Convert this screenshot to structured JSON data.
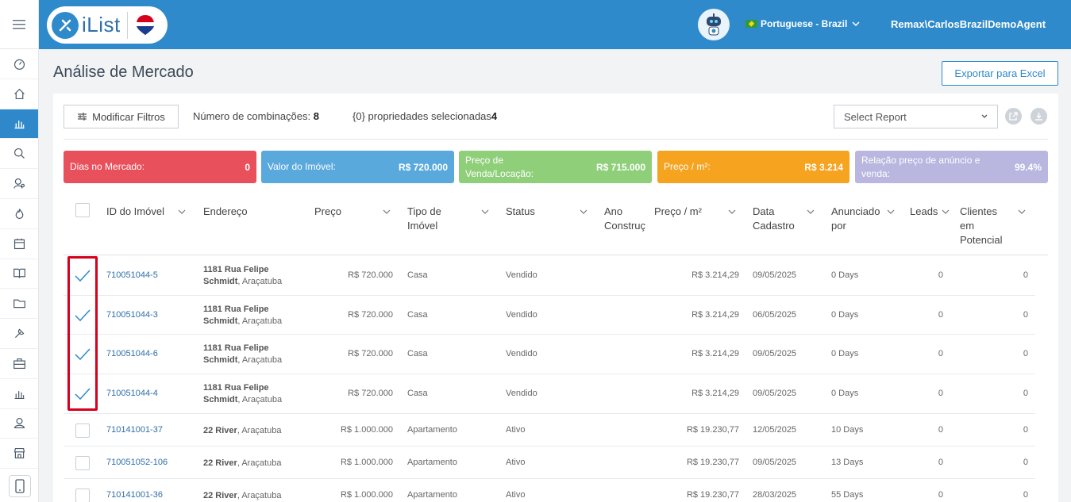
{
  "app": {
    "logo_text": "iList",
    "language": "Portuguese - Brazil",
    "user": "Remax\\CarlosBrazilDemoAgent"
  },
  "page": {
    "title": "Análise de Mercado",
    "export_label": "Exportar para Excel"
  },
  "toolbar": {
    "modify_filters": "Modificar Filtros",
    "combinations_label": "Número de combinações:",
    "combinations_value": "8",
    "selected_label": "{0} propriedades selecionadas",
    "selected_value": "4",
    "select_report_placeholder": "Select Report"
  },
  "kpis": [
    {
      "label": "Dias no Mercado:",
      "value": "0",
      "color": "#e8505b"
    },
    {
      "label": "Valor do Imóvel:",
      "value": "R$ 720.000",
      "color": "#5aa9dd"
    },
    {
      "label": "Preço de Venda/Locação:",
      "value": "R$ 715.000",
      "color": "#8fcf7a"
    },
    {
      "label": "Preço / m²:",
      "value": "R$ 3.214",
      "color": "#f6a320"
    },
    {
      "label": "Relação preço de anúncio e venda:",
      "value": "99.4%",
      "color": "#b9b6e0"
    }
  ],
  "columns": {
    "id": "ID do Imóvel",
    "address": "Endereço",
    "price": "Preço",
    "type_1": "Tipo de",
    "type_2": "Imóvel",
    "status": "Status",
    "year_1": "Ano",
    "year_2": "Construç",
    "ppm": "Preço / m²",
    "date_1": "Data",
    "date_2": "Cadastro",
    "listed_1": "Anunciado",
    "listed_2": "por",
    "leads": "Leads",
    "clients_1": "Clientes",
    "clients_2": "em",
    "clients_3": "Potencial"
  },
  "rows": [
    {
      "checked": true,
      "id": "710051044-5",
      "street": "1181 Rua Felipe",
      "street2": "Schmidt",
      "city": ", Araçatuba",
      "price": "R$ 720.000",
      "type": "Casa",
      "status": "Vendido",
      "ppm": "R$ 3.214,29",
      "date": "09/05/2025",
      "days": "0 Days",
      "leads": "0",
      "clients": "0"
    },
    {
      "checked": true,
      "id": "710051044-3",
      "street": "1181 Rua Felipe",
      "street2": "Schmidt",
      "city": ", Araçatuba",
      "price": "R$ 720.000",
      "type": "Casa",
      "status": "Vendido",
      "ppm": "R$ 3.214,29",
      "date": "06/05/2025",
      "days": "0 Days",
      "leads": "0",
      "clients": "0"
    },
    {
      "checked": true,
      "id": "710051044-6",
      "street": "1181 Rua Felipe",
      "street2": "Schmidt",
      "city": ", Araçatuba",
      "price": "R$ 720.000",
      "type": "Casa",
      "status": "Vendido",
      "ppm": "R$ 3.214,29",
      "date": "09/05/2025",
      "days": "0 Days",
      "leads": "0",
      "clients": "0"
    },
    {
      "checked": true,
      "id": "710051044-4",
      "street": "1181 Rua Felipe",
      "street2": "Schmidt",
      "city": ", Araçatuba",
      "price": "R$ 720.000",
      "type": "Casa",
      "status": "Vendido",
      "ppm": "R$ 3.214,29",
      "date": "09/05/2025",
      "days": "0 Days",
      "leads": "0",
      "clients": "0"
    },
    {
      "checked": false,
      "id": "710141001-37",
      "street": "22 River",
      "street2": "",
      "city": ", Araçatuba",
      "price": "R$ 1.000.000",
      "type": "Apartamento",
      "status": "Ativo",
      "ppm": "R$ 19.230,77",
      "date": "12/05/2025",
      "days": "10 Days",
      "leads": "0",
      "clients": "0"
    },
    {
      "checked": false,
      "id": "710051052-106",
      "street": "22 River",
      "street2": "",
      "city": ", Araçatuba",
      "price": "R$ 1.000.000",
      "type": "Apartamento",
      "status": "Ativo",
      "ppm": "R$ 19.230,77",
      "date": "09/05/2025",
      "days": "13 Days",
      "leads": "0",
      "clients": "0"
    },
    {
      "checked": false,
      "id": "710141001-36",
      "street": "22 River",
      "street2": "",
      "city": ", Araçatuba",
      "price": "R$ 1.000.000",
      "type": "Apartamento",
      "status": "Ativo",
      "ppm": "R$ 19.230,77",
      "date": "28/03/2025",
      "days": "55 Days",
      "leads": "0",
      "clients": "0"
    }
  ]
}
